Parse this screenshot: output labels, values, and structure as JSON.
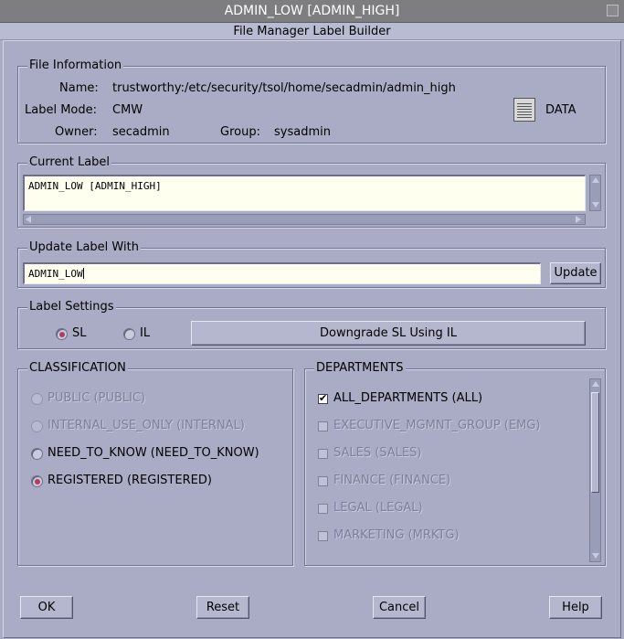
{
  "window": {
    "title": "ADMIN_LOW [ADMIN_HIGH]",
    "subtitle": "File Manager Label Builder"
  },
  "file_info": {
    "legend": "File Information",
    "name_label": "Name:",
    "name_value": "trustworthy:/etc/security/tsol/home/secadmin/admin_high",
    "label_mode_label": "Label Mode:",
    "label_mode_value": "CMW",
    "owner_label": "Owner:",
    "owner_value": "secadmin",
    "group_label": "Group:",
    "group_value": "sysadmin",
    "file_type": "DATA",
    "file_icon": "document-icon"
  },
  "current_label": {
    "legend": "Current Label",
    "value": "ADMIN_LOW [ADMIN_HIGH]"
  },
  "update_label": {
    "legend": "Update Label With",
    "value": "ADMIN_LOW",
    "button": "Update"
  },
  "label_settings": {
    "legend": "Label Settings",
    "options": [
      {
        "label": "SL",
        "selected": true
      },
      {
        "label": "IL",
        "selected": false
      }
    ],
    "downgrade_button": "Downgrade SL Using IL"
  },
  "classification": {
    "legend": "CLASSIFICATION",
    "items": [
      {
        "label": "PUBLIC (PUBLIC)",
        "selected": false,
        "enabled": false
      },
      {
        "label": "INTERNAL_USE_ONLY (INTERNAL)",
        "selected": false,
        "enabled": false
      },
      {
        "label": "NEED_TO_KNOW (NEED_TO_KNOW)",
        "selected": false,
        "enabled": true
      },
      {
        "label": "REGISTERED (REGISTERED)",
        "selected": true,
        "enabled": true
      }
    ]
  },
  "departments": {
    "legend": "DEPARTMENTS",
    "items": [
      {
        "label": "ALL_DEPARTMENTS (ALL)",
        "checked": true,
        "enabled": true
      },
      {
        "label": "EXECUTIVE_MGMNT_GROUP (EMG)",
        "checked": false,
        "enabled": false
      },
      {
        "label": "SALES (SALES)",
        "checked": false,
        "enabled": false
      },
      {
        "label": "FINANCE (FINANCE)",
        "checked": false,
        "enabled": false
      },
      {
        "label": "LEGAL (LEGAL)",
        "checked": false,
        "enabled": false
      },
      {
        "label": "MARKETING (MRKTG)",
        "checked": false,
        "enabled": false
      }
    ]
  },
  "footer": {
    "ok": "OK",
    "reset": "Reset",
    "cancel": "Cancel",
    "help": "Help"
  },
  "colors": {
    "background": "#a9acc4",
    "field": "#fffff0",
    "radio_selected": "#b43c5c"
  }
}
